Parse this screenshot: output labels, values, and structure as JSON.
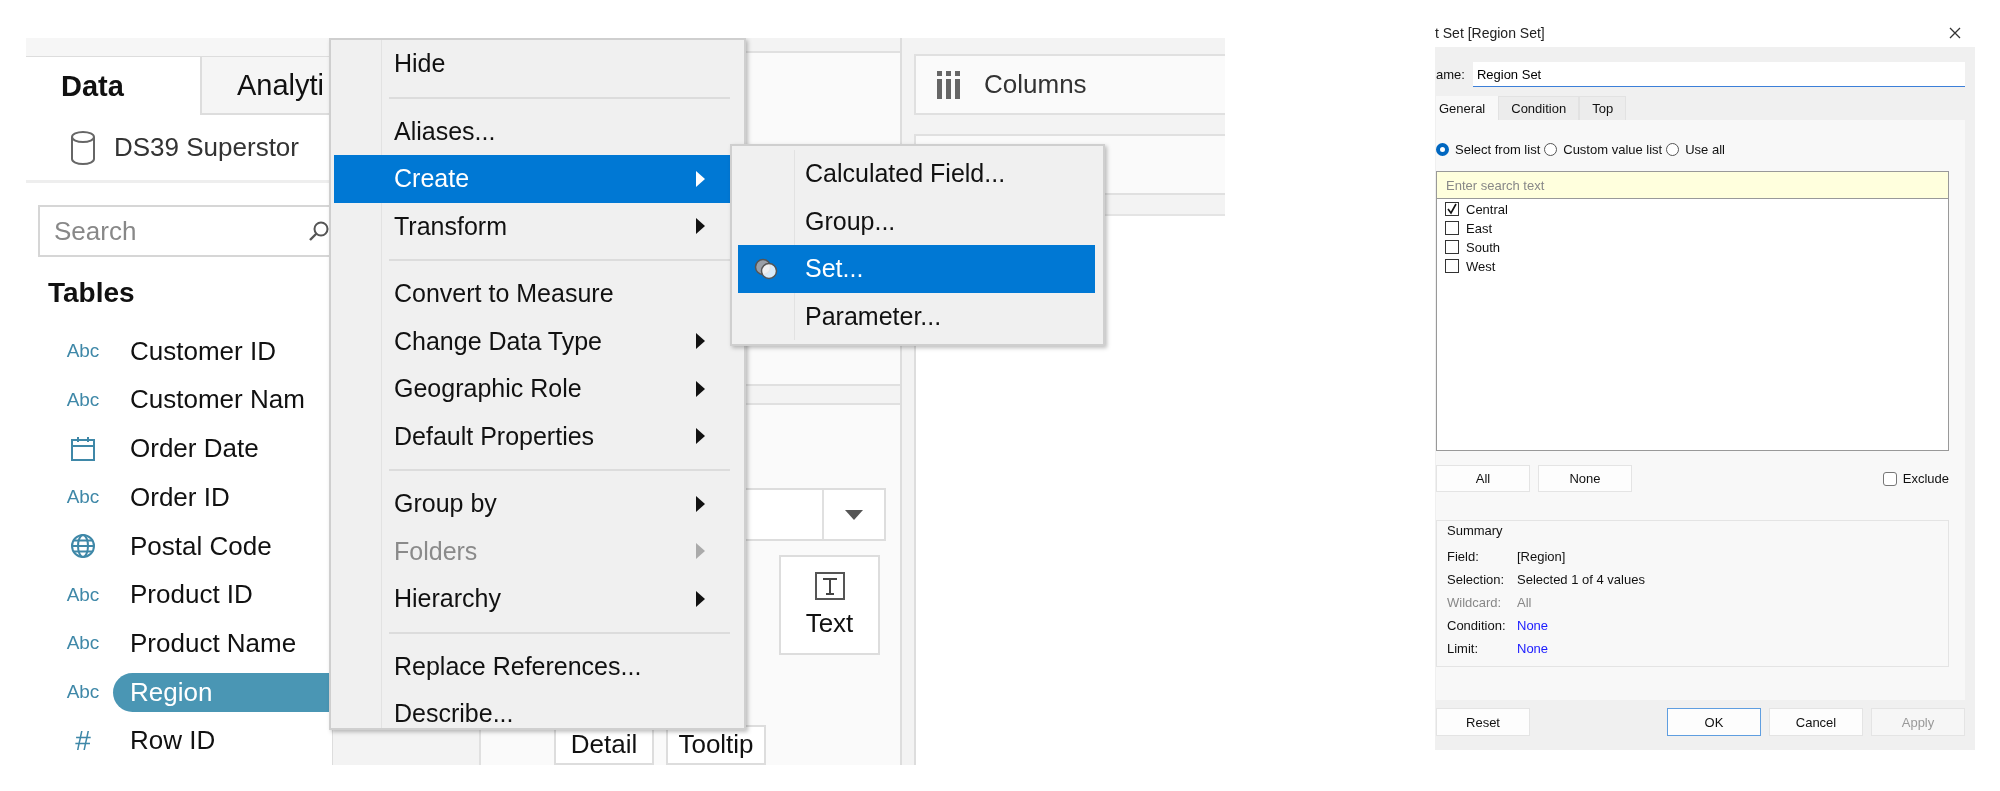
{
  "data_pane": {
    "tabs": [
      {
        "label": "Data",
        "selected": true
      },
      {
        "label": "Analyti",
        "selected": false
      }
    ],
    "datasource": "DS39 Superstor",
    "search": {
      "placeholder": "Search"
    },
    "section_title": "Tables",
    "fields": [
      {
        "kind": "string",
        "type_label": "Abc",
        "name": "Customer ID",
        "selected": false
      },
      {
        "kind": "string",
        "type_label": "Abc",
        "name": "Customer Nam",
        "selected": false
      },
      {
        "kind": "date",
        "name": "Order Date",
        "selected": false
      },
      {
        "kind": "string",
        "type_label": "Abc",
        "name": "Order ID",
        "selected": false
      },
      {
        "kind": "geo",
        "name": "Postal Code",
        "selected": false
      },
      {
        "kind": "string",
        "type_label": "Abc",
        "name": "Product ID",
        "selected": false
      },
      {
        "kind": "string",
        "type_label": "Abc",
        "name": "Product Name",
        "selected": false
      },
      {
        "kind": "string",
        "type_label": "Abc",
        "name": "Region",
        "selected": true
      },
      {
        "kind": "number",
        "type_label": "#",
        "name": "Row ID",
        "selected": false
      }
    ]
  },
  "context_menu": {
    "items": [
      {
        "kind": "item",
        "label": "Hide",
        "selected": false,
        "submenu": false,
        "disabled": false
      },
      {
        "kind": "separator"
      },
      {
        "kind": "item",
        "label": "Aliases...",
        "selected": false,
        "submenu": false,
        "disabled": false
      },
      {
        "kind": "item",
        "label": "Create",
        "selected": true,
        "submenu": true,
        "disabled": false
      },
      {
        "kind": "item",
        "label": "Transform",
        "selected": false,
        "submenu": true,
        "disabled": false
      },
      {
        "kind": "separator"
      },
      {
        "kind": "item",
        "label": "Convert to Measure",
        "selected": false,
        "submenu": false,
        "disabled": false
      },
      {
        "kind": "item",
        "label": "Change Data Type",
        "selected": false,
        "submenu": true,
        "disabled": false
      },
      {
        "kind": "item",
        "label": "Geographic Role",
        "selected": false,
        "submenu": true,
        "disabled": false
      },
      {
        "kind": "item",
        "label": "Default Properties",
        "selected": false,
        "submenu": true,
        "disabled": false
      },
      {
        "kind": "separator"
      },
      {
        "kind": "item",
        "label": "Group by",
        "selected": false,
        "submenu": true,
        "disabled": false
      },
      {
        "kind": "item",
        "label": "Folders",
        "selected": false,
        "submenu": true,
        "disabled": true
      },
      {
        "kind": "item",
        "label": "Hierarchy",
        "selected": false,
        "submenu": true,
        "disabled": false
      },
      {
        "kind": "separator"
      },
      {
        "kind": "item",
        "label": "Replace References...",
        "selected": false,
        "submenu": false,
        "disabled": false
      },
      {
        "kind": "item",
        "label": "Describe...",
        "selected": false,
        "submenu": false,
        "disabled": false
      }
    ]
  },
  "submenu": {
    "items": [
      {
        "label": "Calculated Field...",
        "selected": false,
        "icon": false
      },
      {
        "label": "Group...",
        "selected": false,
        "icon": false
      },
      {
        "label": "Set...",
        "selected": true,
        "icon": true
      },
      {
        "label": "Parameter...",
        "selected": false,
        "icon": false
      }
    ]
  },
  "worksheet": {
    "columns_shelf": "Columns",
    "marks_buttons": [
      {
        "kind": "text",
        "label": "Text"
      },
      {
        "kind": "plain",
        "label": "Detail"
      },
      {
        "kind": "plain",
        "label": "Tooltip"
      }
    ]
  },
  "dialog": {
    "title": "t Set [Region Set]",
    "name_label": "ame:",
    "name_value": "Region Set",
    "tabs": [
      {
        "label": "General",
        "selected": true
      },
      {
        "label": "Condition",
        "selected": false
      },
      {
        "label": "Top",
        "selected": false
      }
    ],
    "radios": [
      {
        "label": "Select from list",
        "selected": true
      },
      {
        "label": "Custom value list",
        "selected": false
      },
      {
        "label": "Use all",
        "selected": false
      }
    ],
    "list_search": {
      "placeholder": "Enter search text"
    },
    "values": [
      {
        "label": "Central",
        "checked": true
      },
      {
        "label": "East",
        "checked": false
      },
      {
        "label": "South",
        "checked": false
      },
      {
        "label": "West",
        "checked": false
      }
    ],
    "list_buttons": [
      "All",
      "None"
    ],
    "exclude": {
      "label": "Exclude",
      "checked": false
    },
    "summary": {
      "title": "Summary",
      "rows": [
        {
          "kind": "plain",
          "label": "Field:",
          "value": "[Region]"
        },
        {
          "kind": "plain",
          "label": "Selection:",
          "value": "Selected 1 of 4 values"
        },
        {
          "kind": "muted",
          "label": "Wildcard:",
          "value": "All"
        },
        {
          "kind": "link",
          "label": "Condition:",
          "value": "None"
        },
        {
          "kind": "link",
          "label": "Limit:",
          "value": "None"
        }
      ]
    },
    "footer_buttons": [
      {
        "label": "Reset",
        "kind": "plain"
      },
      {
        "label": "OK",
        "kind": "default"
      },
      {
        "label": "Cancel",
        "kind": "plain"
      },
      {
        "label": "Apply",
        "kind": "disabled"
      }
    ]
  }
}
